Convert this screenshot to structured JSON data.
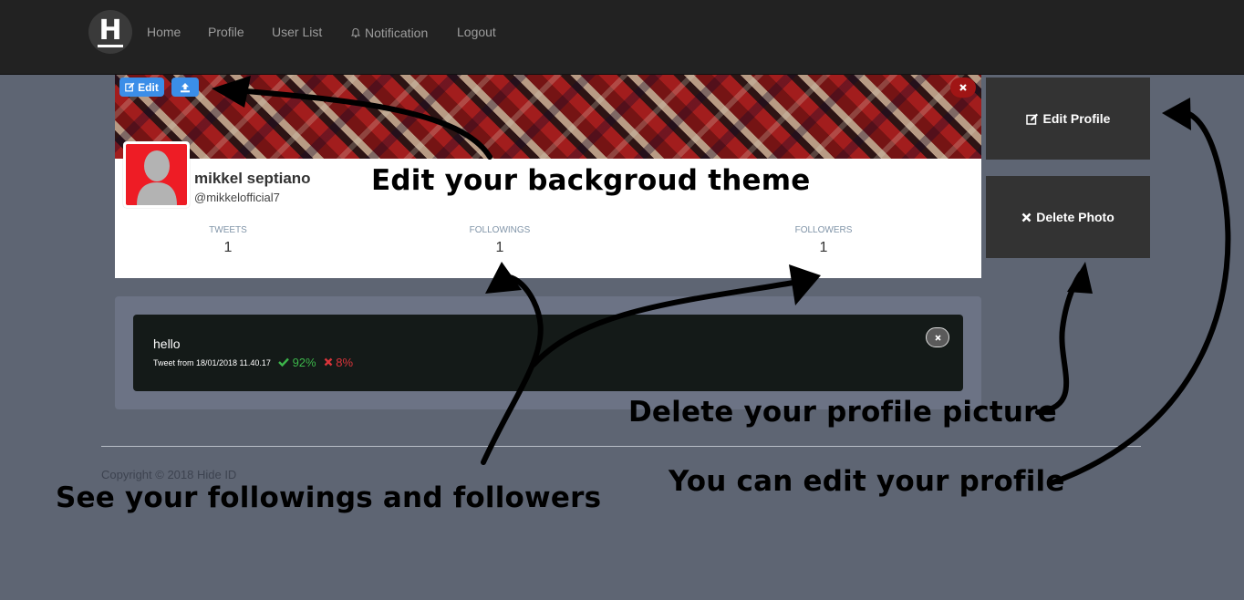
{
  "navbar": {
    "logo_letter": "H",
    "items": [
      {
        "label": "Home"
      },
      {
        "label": "Profile"
      },
      {
        "label": "User List"
      },
      {
        "label": "Notification",
        "icon": "bell-icon"
      },
      {
        "label": "Logout"
      }
    ]
  },
  "profile": {
    "edit_cover_label": "Edit",
    "upload_cover_icon": "upload-icon",
    "remove_cover_icon": "close-icon",
    "name": "mikkel septiano",
    "handle": "@mikkelofficial7",
    "stats": [
      {
        "label": "TWEETS",
        "value": "1"
      },
      {
        "label": "FOLLOWINGS",
        "value": "1"
      },
      {
        "label": "FOLLOWERS",
        "value": "1"
      }
    ]
  },
  "side_panel": {
    "edit_profile_label": "Edit Profile",
    "delete_photo_label": "Delete Photo"
  },
  "tweet": {
    "text": "hello",
    "meta": "Tweet from 18/01/2018 11.40.17",
    "up_percent": "92%",
    "down_percent": "8%"
  },
  "footer": {
    "copyright": "Copyright © 2018 Hide ID"
  },
  "annotations": {
    "background_theme": "Edit your backgroud theme",
    "followings_followers": "See your followings and followers",
    "delete_picture": "Delete your profile picture",
    "edit_profile": "You can edit your profile"
  },
  "colors": {
    "navbar": "#222222",
    "page_bg": "#5e6573",
    "accent_blue": "#3b8ee8",
    "danger_red": "#a01515",
    "tweet_bg": "#141a18",
    "positive": "#3cb54a",
    "negative": "#d9343a"
  }
}
